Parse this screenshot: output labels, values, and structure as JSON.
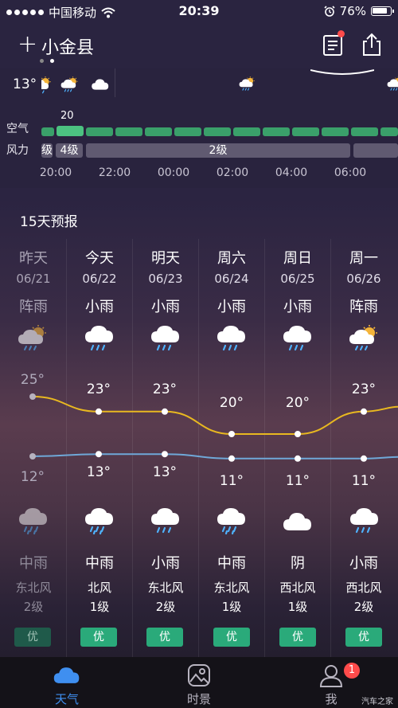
{
  "status": {
    "carrier": "中国移动",
    "time": "20:39",
    "battery": "76%"
  },
  "header": {
    "city": "小金县",
    "add_icon": "plus-icon",
    "news_icon": "news-icon",
    "share_icon": "share-icon"
  },
  "hourly": {
    "current_temp": "13°",
    "aqi_label": "空气",
    "wind_label": "风力",
    "aqi_value": "20",
    "wind_segments": [
      "级",
      "4级",
      "2级"
    ],
    "times": [
      "20:00",
      "22:00",
      "00:00",
      "02:00",
      "04:00",
      "06:00"
    ]
  },
  "forecast_title": "15天预报",
  "days": [
    {
      "name": "昨天",
      "date": "06/21",
      "day_cond": "阵雨",
      "high": "25°",
      "low": "12°",
      "night_cond": "中雨",
      "wind_dir": "东北风",
      "wind_level": "2级",
      "aq": "优",
      "past": true
    },
    {
      "name": "今天",
      "date": "06/22",
      "day_cond": "小雨",
      "high": "23°",
      "low": "13°",
      "night_cond": "中雨",
      "wind_dir": "北风",
      "wind_level": "1级",
      "aq": "优",
      "past": false
    },
    {
      "name": "明天",
      "date": "06/23",
      "day_cond": "小雨",
      "high": "23°",
      "low": "13°",
      "night_cond": "小雨",
      "wind_dir": "东北风",
      "wind_level": "2级",
      "aq": "优",
      "past": false
    },
    {
      "name": "周六",
      "date": "06/24",
      "day_cond": "小雨",
      "high": "20°",
      "low": "11°",
      "night_cond": "中雨",
      "wind_dir": "东北风",
      "wind_level": "1级",
      "aq": "优",
      "past": false
    },
    {
      "name": "周日",
      "date": "06/25",
      "day_cond": "小雨",
      "high": "20°",
      "low": "11°",
      "night_cond": "阴",
      "wind_dir": "西北风",
      "wind_level": "1级",
      "aq": "优",
      "past": false
    },
    {
      "name": "周一",
      "date": "06/26",
      "day_cond": "阵雨",
      "high": "23°",
      "low": "11°",
      "night_cond": "小雨",
      "wind_dir": "西北风",
      "wind_level": "2级",
      "aq": "优",
      "past": false
    }
  ],
  "tabs": [
    {
      "label": "天气",
      "icon": "cloud-icon",
      "active": true
    },
    {
      "label": "时景",
      "icon": "photo-icon",
      "active": false
    },
    {
      "label": "我",
      "icon": "user-icon",
      "active": false
    }
  ],
  "me_badge": "1",
  "watermark": "汽车之家",
  "colors": {
    "accent": "#3f8ff0",
    "high_line": "#e8b820",
    "low_line": "#6fa8d8",
    "aqi_green": "#3aa06a",
    "badge_red": "#ff4b4b"
  }
}
